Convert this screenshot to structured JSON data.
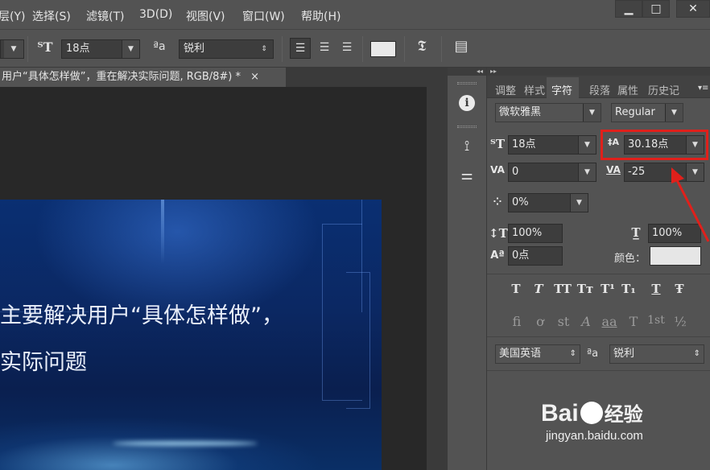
{
  "menubar": {
    "items": [
      "层(Y)",
      "选择(S)",
      "滤镜(T)",
      "3D(D)",
      "视图(V)",
      "窗口(W)",
      "帮助(H)"
    ],
    "window_controls": [
      "▁",
      "□",
      "✕"
    ]
  },
  "options": {
    "font_size": "18点",
    "antialias_icon_text": "ªa",
    "antialias": "锐利"
  },
  "document": {
    "tab_title": "用户“具体怎样做”，重在解决实际问题, RGB/8#) *",
    "close": "×"
  },
  "canvas": {
    "line1": "主要解决用户“具体怎样做”，",
    "line2": "实际问题"
  },
  "panel": {
    "tabs": [
      "调整",
      "样式",
      "字符",
      "段落",
      "属性",
      "历史记"
    ],
    "active_tab": "字符",
    "font_family": "微软雅黑",
    "font_style": "Regular",
    "font_size": "18点",
    "leading": "30.18点",
    "kerning": "0",
    "tracking": "-25",
    "tsume": "0%",
    "vertical_scale": "100%",
    "horizontal_scale": "100%",
    "baseline_shift": "0点",
    "color_label": "颜色：",
    "color_swatch": "#e6e6e6",
    "style_buttons": [
      "T",
      "T",
      "TT",
      "Tт",
      "T¹",
      "T₁",
      "T",
      "Ŧ"
    ],
    "ligature_buttons": [
      "fi",
      "ơ",
      "st",
      "A",
      "aa",
      "T",
      "1st",
      "½"
    ],
    "language": "美国英语",
    "aa_icon_text": "ªa",
    "antialias": "锐利"
  },
  "accent_color": "#e0201b",
  "watermark": {
    "brand": "Bai",
    "brand_suffix": "经验",
    "url": "jingyan.baidu.com"
  }
}
